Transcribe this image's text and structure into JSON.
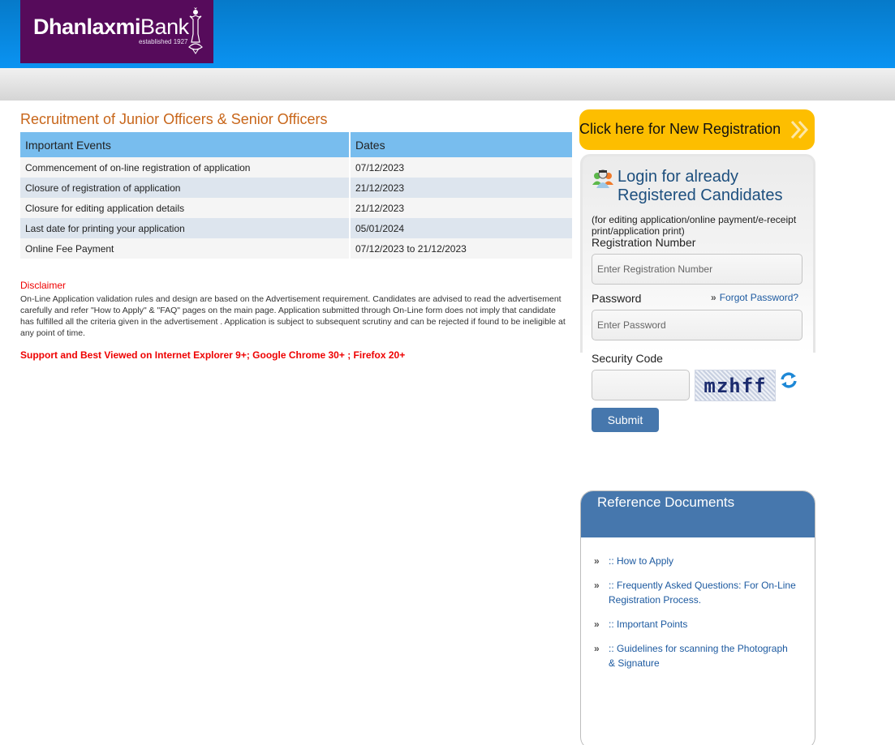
{
  "header": {
    "logo": {
      "name_bold": "Dhanlaxmi",
      "name_light": "Bank",
      "tagline": "established 1927"
    }
  },
  "main": {
    "title": "Recruitment of Junior Officers & Senior Officers",
    "events_table": {
      "headers": [
        "Important Events",
        "Dates"
      ],
      "rows": [
        [
          "Commencement of on-line registration of application",
          "07/12/2023"
        ],
        [
          "Closure of registration of application",
          "21/12/2023"
        ],
        [
          "Closure for editing application details",
          "21/12/2023"
        ],
        [
          "Last date for printing your application",
          "05/01/2024"
        ],
        [
          "Online Fee Payment",
          "07/12/2023 to 21/12/2023"
        ]
      ]
    },
    "disclaimer": {
      "title": "Disclaimer",
      "text": "On-Line Application validation rules and design are based on the Advertisement requirement. Candidates are advised to read the advertisement carefully and refer \"How to Apply\" & \"FAQ\" pages on the main page. Application submitted through On-Line form does not imply that candidate has fulfilled all the criteria given in the advertisement . Application is subject to subsequent scrutiny and can be rejected if found to be ineligible at any point of time."
    },
    "support_note": "Support and Best Viewed on Internet Explorer 9+; Google Chrome 30+ ; Firefox 20+"
  },
  "sidebar": {
    "new_registration": {
      "label": "Click here for New Registration",
      "icon": "double-chevron-right-icon"
    },
    "login": {
      "icon": "users-icon",
      "title": "Login for already Registered Candidates",
      "subtitle": "(for editing application/online payment/e-receipt print/application print)",
      "registration_label": "Registration Number",
      "registration_placeholder": "Enter Registration Number",
      "registration_value": "",
      "password_label": "Password",
      "password_placeholder": "Enter Password",
      "password_value": "",
      "forgot_password": "Forgot Password?",
      "security_label": "Security Code",
      "security_value": "",
      "captcha_text": "mzhff",
      "refresh_icon": "refresh-icon",
      "submit_label": "Submit"
    },
    "reference": {
      "title": "Reference Documents",
      "items": [
        {
          "label": ":: How to Apply"
        },
        {
          "label": ":: Frequently Asked Questions: For On-Line Registration Process."
        },
        {
          "label": ":: Important Points"
        },
        {
          "label": ":: Guidelines for scanning the Photograph & Signature"
        }
      ]
    }
  },
  "colors": {
    "header_blue": "#0a93f2",
    "logo_purple": "#560b5b",
    "title_orange": "#c8661a",
    "table_header": "#78bdee",
    "registration_yellow": "#fdbe00",
    "panel_blue": "#4677ad",
    "disclaimer_red": "#ee0000",
    "link_blue": "#1d5aa0"
  }
}
